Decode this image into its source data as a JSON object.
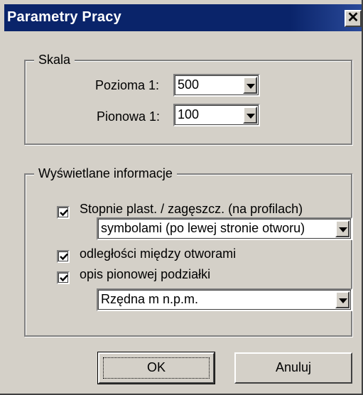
{
  "window": {
    "title": "Parametry Pracy",
    "close_glyph": "✕"
  },
  "scale": {
    "group_label": "Skala",
    "horizontal_label": "Pozioma  1:",
    "horizontal_value": "500",
    "vertical_label": "Pionowa  1:",
    "vertical_value": "100"
  },
  "display": {
    "group_label": "Wyświetlane informacje",
    "degrees_label": "Stopnie plast. / zagęszcz. (na profilach)",
    "degrees_checked": true,
    "degrees_mode_value": "symbolami (po lewej stronie otworu)",
    "distances_label": "odległości między otworami",
    "distances_checked": true,
    "vertical_scale_desc_label": "opis pionowej podziałki",
    "vertical_scale_desc_checked": true,
    "elevation_value": "Rzędna m n.p.m."
  },
  "buttons": {
    "ok": "OK",
    "cancel": "Anuluj"
  },
  "icons": {
    "close": "close-icon",
    "dropdown": "chevron-down-icon",
    "check": "checkmark-icon"
  }
}
